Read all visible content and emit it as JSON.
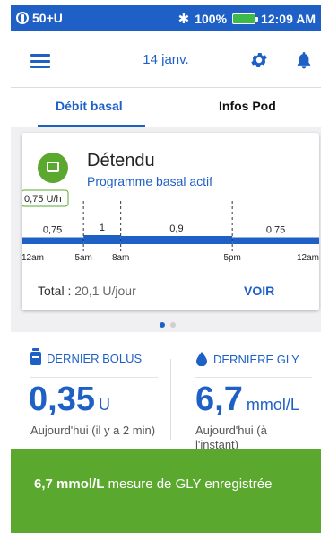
{
  "status_bar": {
    "carrier": "50+U",
    "battery": "100%",
    "time": "12:09 AM",
    "accent_color": "#1f60c7",
    "battery_color": "#3dbb4a"
  },
  "header": {
    "date": "14 janv.",
    "menu_icon": "hamburger-menu-icon",
    "settings_icon": "gear-icon",
    "notifications_icon": "bell-icon"
  },
  "tabs": [
    {
      "label": "Débit basal",
      "active": true
    },
    {
      "label": "Infos Pod",
      "active": false
    }
  ],
  "basal_card": {
    "program_name": "Détendu",
    "program_status": "Programme basal actif",
    "current_rate": "0,75 U/h",
    "icon_color": "#5aa82e",
    "segments": [
      {
        "label": "0,75",
        "start": 0,
        "end": 5,
        "rate": 0.75
      },
      {
        "label": "1",
        "start": 5,
        "end": 8,
        "rate": 1.0
      },
      {
        "label": "0,9",
        "start": 8,
        "end": 17,
        "rate": 0.9
      },
      {
        "label": "0,75",
        "start": 17,
        "end": 24,
        "rate": 0.75
      }
    ],
    "time_ticks": [
      {
        "label": "12am",
        "hour": 0
      },
      {
        "label": "5am",
        "hour": 5
      },
      {
        "label": "8am",
        "hour": 8
      },
      {
        "label": "5pm",
        "hour": 17
      },
      {
        "label": "12am",
        "hour": 24
      }
    ],
    "total_label": "Total :",
    "total_value": "20,1 U/jour",
    "view_button": "VOIR"
  },
  "pager": {
    "pages": 2,
    "current": 1
  },
  "last_bolus": {
    "title": "DERNIER BOLUS",
    "value": "0,35",
    "unit": "U",
    "note": "Aujourd'hui (il y a 2 min)",
    "icon": "insulin-vial-icon"
  },
  "last_glucose": {
    "title": "DERNIÈRE GLY",
    "value": "6,7",
    "unit": "mmol/L",
    "note": "Aujourd'hui (à l'instant)",
    "icon": "blood-drop-icon"
  },
  "banner": {
    "highlight": "6,7 mmol/L",
    "message": " mesure de GLY enregistrée",
    "color": "#5aa82e"
  }
}
